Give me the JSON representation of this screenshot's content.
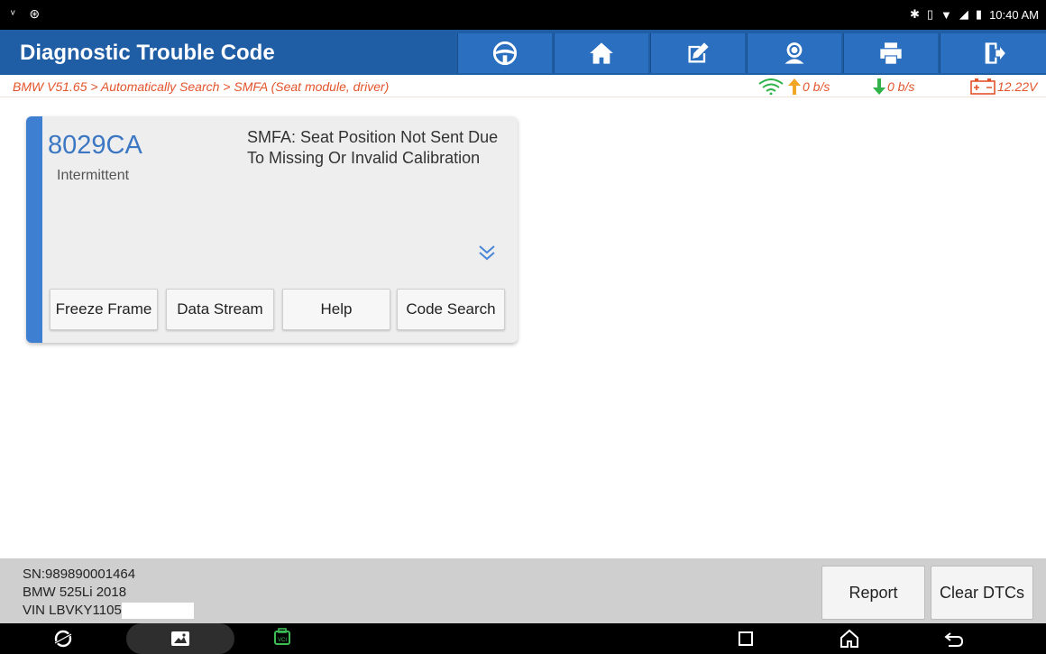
{
  "status_bar": {
    "left_icons": "ᵛ ⊛",
    "time": "10:40 AM"
  },
  "header": {
    "title": "Diagnostic Trouble Code",
    "toolbar": [
      {
        "icon": "steering-wheel-icon"
      },
      {
        "icon": "home-icon"
      },
      {
        "icon": "edit-icon"
      },
      {
        "icon": "support-agent-icon"
      },
      {
        "icon": "printer-icon"
      },
      {
        "icon": "exit-icon"
      }
    ]
  },
  "breadcrumb": "BMW V51.65 > Automatically Search > SMFA (Seat module, driver)",
  "connection": {
    "upload": "0 b/s",
    "download": "0 b/s",
    "battery": "12.22V"
  },
  "dtc": {
    "code": "8029CA",
    "status": "Intermittent",
    "description": "SMFA: Seat Position Not Sent Due To Missing Or Invalid Calibration",
    "buttons": [
      "Freeze Frame",
      "Data Stream",
      "Help",
      "Code Search"
    ]
  },
  "footer": {
    "sn": "SN:989890001464",
    "vehicle": "BMW 525Li 2018",
    "vin": "VIN LBVKY1105",
    "report_label": "Report",
    "clear_label": "Clear DTCs"
  },
  "colors": {
    "accent": "#1f5da5",
    "dtc_blue": "#3b77c3",
    "breadcrumb": "#e2542b"
  }
}
